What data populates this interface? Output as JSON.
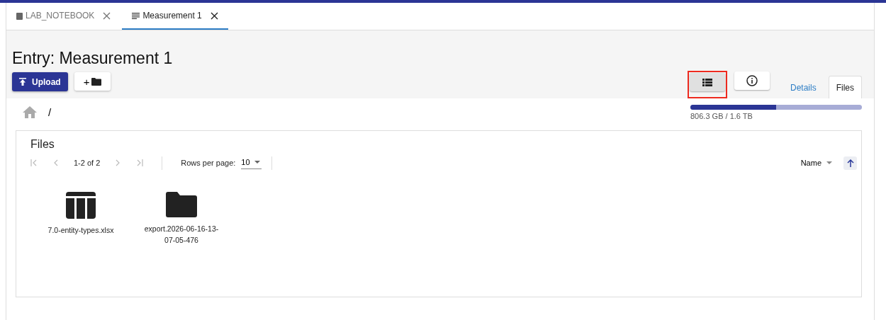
{
  "tabs": [
    {
      "kind": "notebook",
      "label": "LAB_NOTEBOOK",
      "selected": false
    },
    {
      "kind": "entry",
      "label": "Measurement 1",
      "selected": true
    }
  ],
  "title": "Entry: Measurement 1",
  "toolbar": {
    "upload_label": "Upload",
    "new_folder_label": "+"
  },
  "view_buttons": [
    {
      "kind": "list",
      "selected": true,
      "highlighted": true
    },
    {
      "kind": "info",
      "selected": false,
      "highlighted": false
    }
  ],
  "side_tabs": [
    {
      "label": "Details",
      "selected": false
    },
    {
      "label": "Files",
      "selected": true
    }
  ],
  "breadcrumb": "/",
  "storage": {
    "level": 0.5,
    "reading": "806.3 GB / 1.6 TB"
  },
  "files_panel": {
    "title": "Files",
    "range": "1-2 of 2",
    "rows_label": "Rows per page:",
    "rows_value": "10",
    "sort_label": "Name",
    "items": [
      {
        "kind": "spreadsheet",
        "name": "7.0-entity-types.xlsx"
      },
      {
        "kind": "folder",
        "name": "export.2026-06-16-13-07-05-476"
      }
    ]
  }
}
